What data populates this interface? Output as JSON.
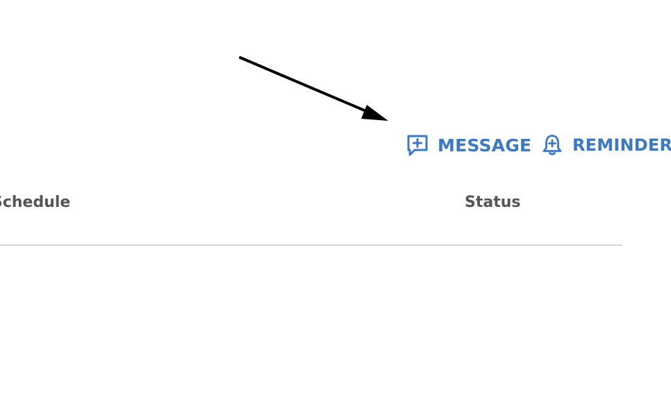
{
  "actions": {
    "message": {
      "label": "MESSAGE",
      "icon": "message-plus-icon"
    },
    "reminder": {
      "label": "REMINDER",
      "icon": "bell-plus-icon"
    }
  },
  "table": {
    "columns": [
      {
        "label": "Schedule"
      },
      {
        "label": "Status"
      }
    ]
  },
  "colors": {
    "accent": "#3a78c9",
    "header_text": "#555555",
    "divider": "#d6d6d6",
    "arrow": "#000000"
  },
  "annotation": {
    "icon": "pointer-arrow-icon"
  }
}
